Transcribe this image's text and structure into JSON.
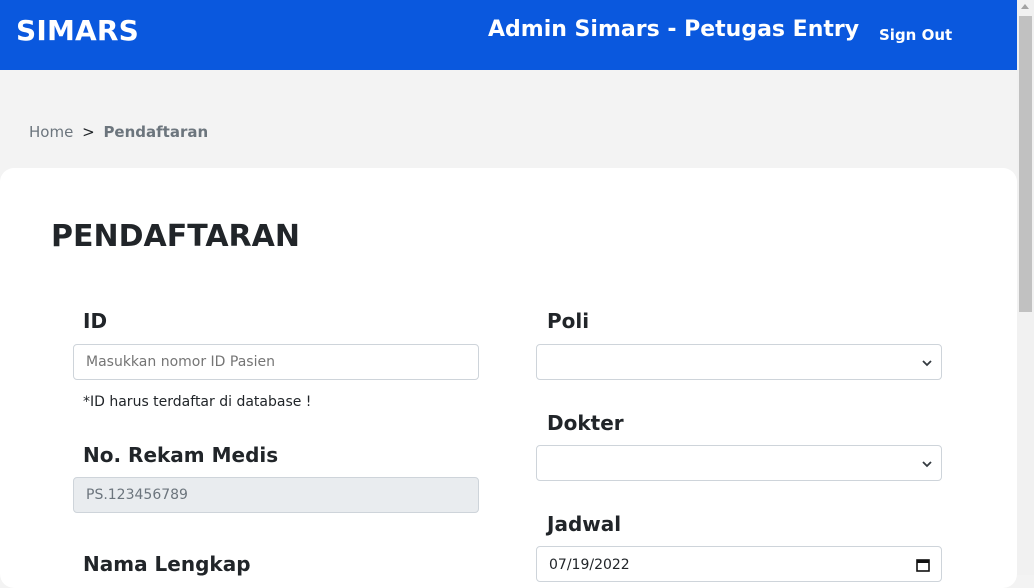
{
  "navbar": {
    "brand": "SIMARS",
    "title": "Admin Simars - Petugas Entry",
    "signout_label": "Sign Out",
    "bg_color": "#0a58de"
  },
  "breadcrumb": {
    "home": "Home",
    "separator": ">",
    "current": "Pendaftaran"
  },
  "form": {
    "title": "PENDAFTARAN",
    "id_label": "ID",
    "id_placeholder": "Masukkan nomor ID Pasien",
    "id_help": "*ID harus terdaftar di database !",
    "rekam_medis_label": "No. Rekam Medis",
    "rekam_medis_value": "PS.123456789",
    "nama_label": "Nama Lengkap",
    "poli_label": "Poli",
    "poli_value": "",
    "dokter_label": "Dokter",
    "dokter_value": "",
    "jadwal_label": "Jadwal",
    "jadwal_value": "07/19/2022"
  },
  "icons": {
    "select_chevron": "chevron-down-icon",
    "date_picker": "calendar-icon"
  }
}
